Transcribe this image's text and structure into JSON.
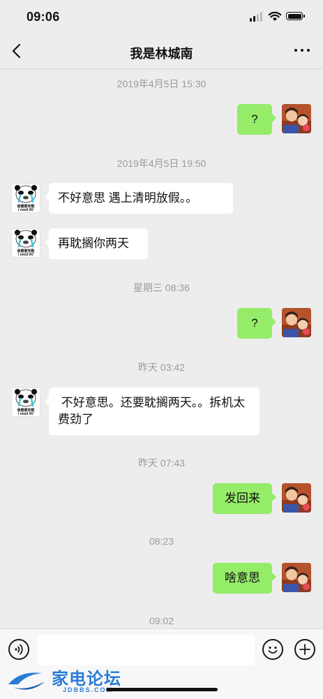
{
  "status_bar": {
    "time": "09:06",
    "icons": [
      "cellular-signal-icon",
      "wifi-icon",
      "battery-icon"
    ]
  },
  "header": {
    "back_icon": "chevron-left-icon",
    "title": "我是林城南",
    "more_icon": "more-dots-icon"
  },
  "messages": [
    {
      "type": "timestamp",
      "text": "2019年4月5日 15:30"
    },
    {
      "type": "message",
      "sender": "me",
      "text": "?"
    },
    {
      "type": "timestamp",
      "text": "2019年4月5日 19:50"
    },
    {
      "type": "message",
      "sender": "contact",
      "text": "不好意思 遇上清明放假。。"
    },
    {
      "type": "message",
      "sender": "contact",
      "text": "再耽搁你两天"
    },
    {
      "type": "timestamp",
      "text": "星期三 08:36"
    },
    {
      "type": "message",
      "sender": "me",
      "text": "?"
    },
    {
      "type": "timestamp",
      "text": "昨天 03:42"
    },
    {
      "type": "message",
      "sender": "contact",
      "text": " 不好意思。还要耽搁两天。。拆机太费劲了"
    },
    {
      "type": "timestamp",
      "text": "昨天 07:43"
    },
    {
      "type": "message",
      "sender": "me",
      "text": "发回来"
    },
    {
      "type": "timestamp",
      "text": "08:23"
    },
    {
      "type": "message",
      "sender": "me",
      "text": "啥意思"
    },
    {
      "type": "timestamp",
      "text": "09:02"
    }
  ],
  "contact_avatar": {
    "caption_line1": "我需要安慰",
    "caption_line2": "i need AV"
  },
  "input_bar": {
    "voice_icon": "voice-icon",
    "emoji_icon": "emoji-icon",
    "plus_icon": "plus-icon",
    "text_value": ""
  },
  "watermark": {
    "text": "家电论坛",
    "sub": "JDBBS.COM"
  },
  "colors": {
    "background": "#ededed",
    "my_bubble": "#95ec69",
    "their_bubble": "#ffffff",
    "timestamp": "#9b9b9b",
    "watermark": "#2a7bd6"
  }
}
